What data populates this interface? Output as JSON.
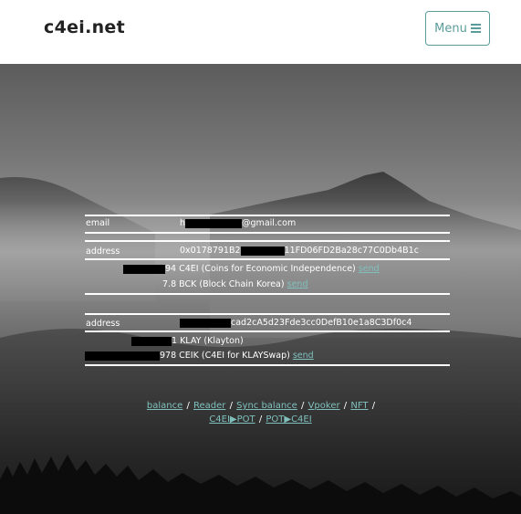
{
  "navbar": {
    "brand": "c4ei.net",
    "menu_label": "Menu"
  },
  "account": {
    "email_label": "email",
    "email_prefix": "h",
    "email_suffix": "@gmail.com",
    "address1_label": "address",
    "address1_prefix": "0x0178791B2",
    "address1_suffix": "11FD06FD2Ba28c77C0Db4B1c",
    "c4ei_amount_suffix": "94",
    "c4ei_desc": "C4EI (Coins for Economic Independence)",
    "c4ei_send": "send",
    "bck_amount": "7.8",
    "bck_desc": "BCK (Block Chain Korea)",
    "bck_send": "send",
    "address2_label": "address",
    "address2_suffix": "cad2cA5d23Fde3cc0DefB10e1a8C3Df0c4",
    "klay_amount_suffix": "1",
    "klay_desc": "KLAY (Klayton)",
    "ceik_amount_suffix": "978",
    "ceik_desc": "CEIK (C4EI for KLAYSwap)",
    "ceik_send": "send"
  },
  "footer": {
    "links": [
      "balance",
      "Reader",
      "Sync balance",
      "Vpoker",
      "NFT"
    ],
    "separator": "/",
    "swap_links": [
      "C4EI▶POT",
      "POT▶C4EI"
    ]
  }
}
